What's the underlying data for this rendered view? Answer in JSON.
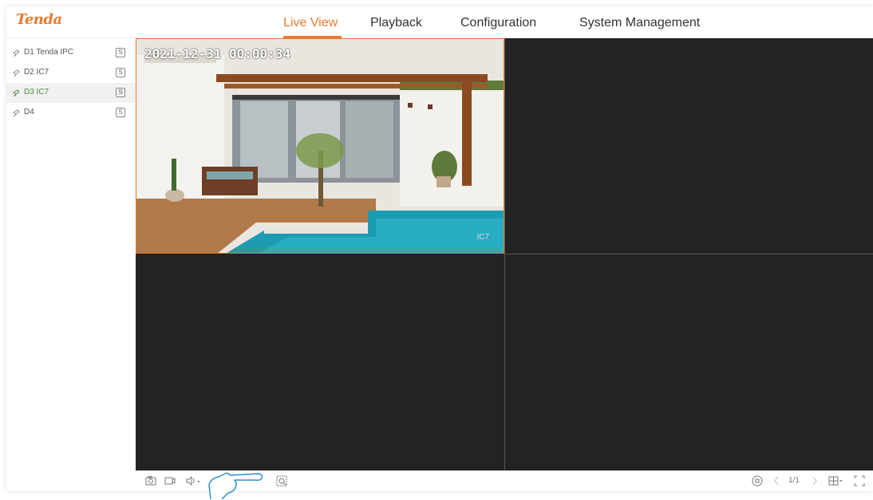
{
  "header": {
    "logo": "Tenda",
    "nav": [
      {
        "label": "Live View",
        "active": true
      },
      {
        "label": "Playback",
        "active": false
      },
      {
        "label": "Configuration",
        "active": false
      },
      {
        "label": "System Management",
        "active": false
      }
    ]
  },
  "sidebar": {
    "items": [
      {
        "label": "D1 Tenda IPC",
        "badge": "S",
        "icon": "camera-icon"
      },
      {
        "label": "D2 IC7",
        "badge": "S",
        "icon": "camera-icon"
      },
      {
        "label": "D3 IC7",
        "badge": "S",
        "icon": "camera-icon",
        "selected": true
      },
      {
        "label": "D4",
        "badge": "S",
        "icon": "camera-icon"
      }
    ]
  },
  "video": {
    "pane1": {
      "timestamp": "2021-12-31 00:00:34",
      "camera_label": "IC7"
    }
  },
  "toolbar": {
    "left_icons": [
      "snapshot-icon",
      "record-icon",
      "volume-icon",
      "zoom-icon"
    ],
    "page": "1/1",
    "right_icons": [
      "stop-all-icon",
      "prev-page-icon",
      "next-page-icon",
      "layout-icon",
      "fullscreen-icon"
    ]
  },
  "colors": {
    "accent": "#e97b2c",
    "video_bg": "#232323",
    "selected_text": "#4a8a3a"
  }
}
